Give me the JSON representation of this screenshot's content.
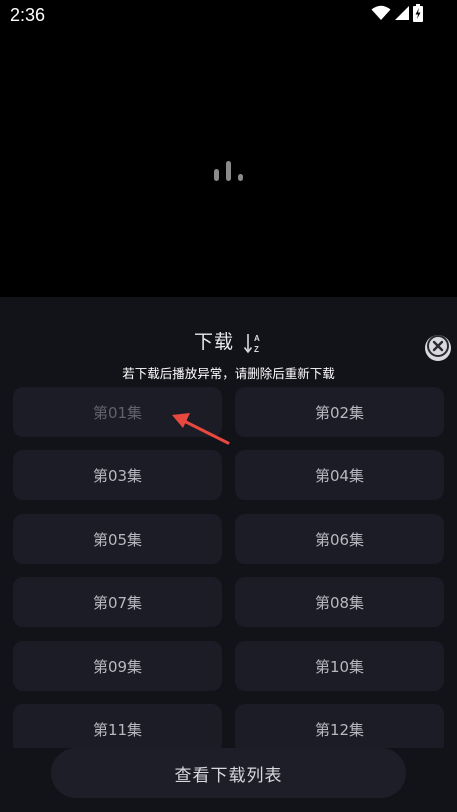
{
  "status_bar": {
    "time": "2:36",
    "icons": [
      "wifi-icon",
      "cellular-signal-icon",
      "battery-charging-icon"
    ]
  },
  "player": {
    "state_icon": "loading-bars-icon"
  },
  "download_sheet": {
    "title": "下载",
    "sort_icon": "sort-alpha-icon",
    "close_icon": "close-icon",
    "notice": "若下载后播放异常，请删除后重新下载",
    "episodes": [
      {
        "label": "第01集",
        "dimmed": true
      },
      {
        "label": "第02集",
        "dimmed": false
      },
      {
        "label": "第03集",
        "dimmed": false
      },
      {
        "label": "第04集",
        "dimmed": false
      },
      {
        "label": "第05集",
        "dimmed": false
      },
      {
        "label": "第06集",
        "dimmed": false
      },
      {
        "label": "第07集",
        "dimmed": false
      },
      {
        "label": "第08集",
        "dimmed": false
      },
      {
        "label": "第09集",
        "dimmed": false
      },
      {
        "label": "第10集",
        "dimmed": false
      },
      {
        "label": "第11集",
        "dimmed": false
      },
      {
        "label": "第12集",
        "dimmed": false
      }
    ],
    "view_list_button": "查看下载列表"
  },
  "annotation": {
    "arrow_color": "#e8483f"
  },
  "colors": {
    "sheet_bg": "#121219",
    "episode_bg": "#1c1c26",
    "episode_text": "#b8b8c0",
    "episode_dimmed_text": "#62626c"
  }
}
